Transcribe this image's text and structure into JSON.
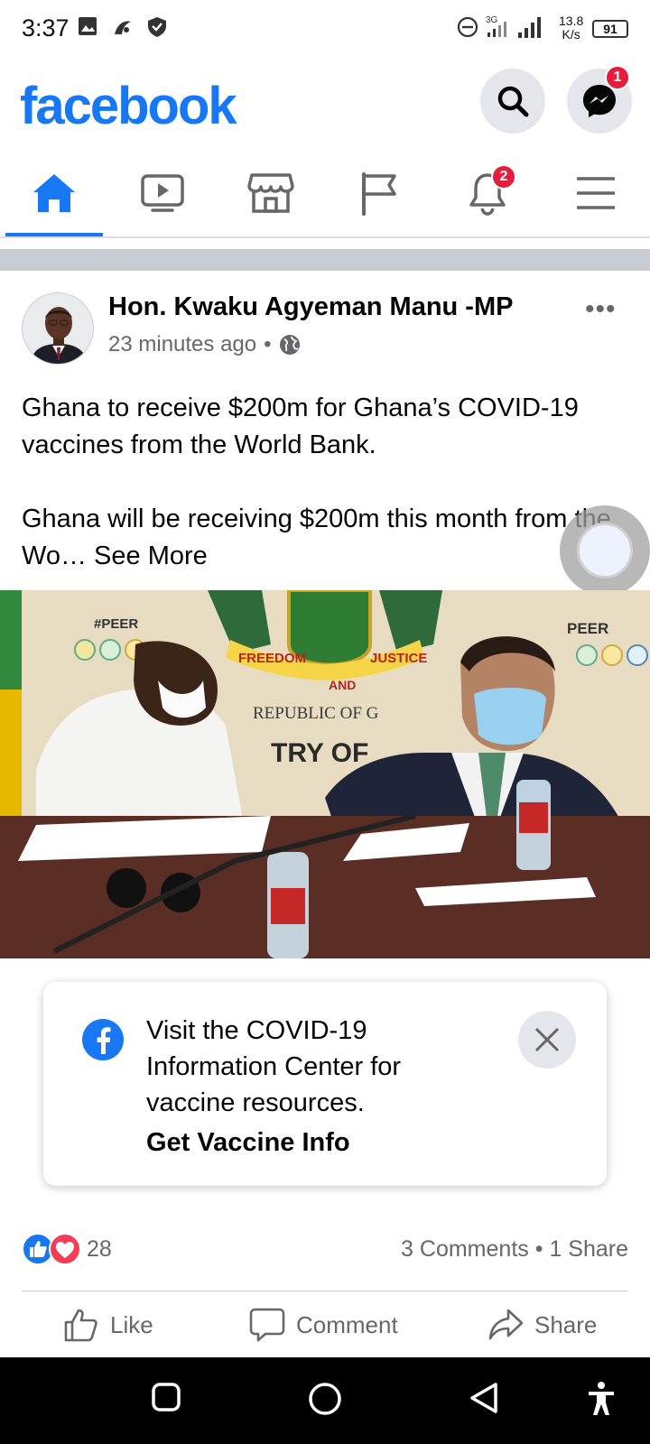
{
  "status_bar": {
    "time": "3:37",
    "network_rate_value": "13.8",
    "network_rate_unit": "K/s",
    "battery": "91",
    "signal_label": "3G"
  },
  "header": {
    "app_title": "facebook",
    "messenger_badge": "1",
    "brand_color": "#1877f2"
  },
  "tabs": [
    {
      "name": "home",
      "icon": "home-icon",
      "active": true
    },
    {
      "name": "watch",
      "icon": "video-icon"
    },
    {
      "name": "marketplace",
      "icon": "store-icon"
    },
    {
      "name": "pages",
      "icon": "flag-icon"
    },
    {
      "name": "notifications",
      "icon": "bell-icon",
      "badge": "2"
    },
    {
      "name": "menu",
      "icon": "menu-icon"
    }
  ],
  "post": {
    "author": "Hon. Kwaku Agyeman Manu -MP",
    "time": "23 minutes ago",
    "separator": "•",
    "privacy_icon": "globe-icon",
    "text_para1": "Ghana to receive $200m for Ghana’s COVID-19 vaccines from the World Bank.",
    "text_para2": "Ghana will be receiving $200m this month from the Wo…",
    "see_more": "See More",
    "photo_text": {
      "hashtag_left": "#PEER",
      "hashtag_right": "PEER",
      "motto_left": "FREEDOM",
      "motto_and": "AND",
      "motto_right": "JUSTICE",
      "republic": "REPUBLIC OF G",
      "ministry": "TRY OF"
    }
  },
  "covid_card": {
    "text": "Visit the COVID-19 Information Center for vaccine resources.",
    "link": "Get Vaccine Info"
  },
  "engagement": {
    "reaction_count": "28",
    "comments": "3 Comments",
    "separator": "•",
    "shares": "1 Share"
  },
  "actions": {
    "like": "Like",
    "comment": "Comment",
    "share": "Share"
  }
}
